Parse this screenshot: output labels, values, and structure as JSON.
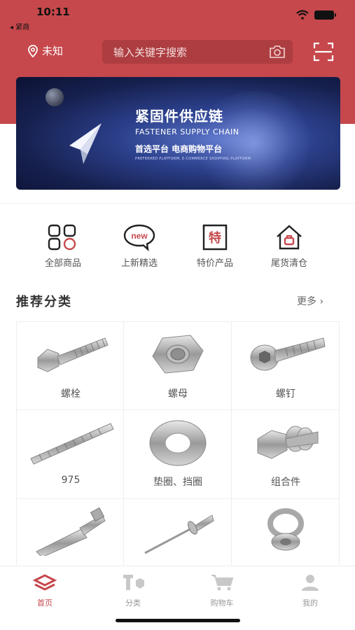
{
  "status_bar": {
    "time": "10:11",
    "back_label": "◂ 紧商"
  },
  "header": {
    "location": "未知",
    "search_placeholder": "输入关键字搜索"
  },
  "banner": {
    "title": "紧固件供应链",
    "subtitle_en": "FASTENER SUPPLY CHAIN",
    "subtitle_cn": "首选平台 电商购物平台",
    "tagline": "PREFERRED PLATFORM, E-COMMERCE SHOPPING PLATFORM"
  },
  "quick_nav": [
    {
      "label": "全部商品",
      "icon": "grid-icon"
    },
    {
      "label": "上新精选",
      "icon": "new-badge-icon",
      "badge": "new"
    },
    {
      "label": "特价产品",
      "icon": "special-price-icon",
      "glyph": "特"
    },
    {
      "label": "尾货清仓",
      "icon": "clearance-house-icon"
    }
  ],
  "recommended": {
    "title": "推荐分类",
    "more_label": "更多 ›",
    "categories": [
      {
        "label": "螺栓",
        "icon": "bolt-icon"
      },
      {
        "label": "螺母",
        "icon": "nut-icon"
      },
      {
        "label": "螺钉",
        "icon": "screw-icon"
      },
      {
        "label": "975",
        "icon": "threaded-rod-icon"
      },
      {
        "label": "垫圈、挡圈",
        "icon": "washer-icon"
      },
      {
        "label": "组合件",
        "icon": "assembly-icon"
      },
      {
        "label": "",
        "icon": "anchor-bolt-icon"
      },
      {
        "label": "",
        "icon": "rivet-icon"
      },
      {
        "label": "",
        "icon": "eye-bolt-icon"
      }
    ]
  },
  "tabbar": [
    {
      "label": "首页",
      "icon": "home-logo-icon",
      "active": true
    },
    {
      "label": "分类",
      "icon": "category-icon",
      "active": false
    },
    {
      "label": "购物车",
      "icon": "cart-icon",
      "active": false
    },
    {
      "label": "我的",
      "icon": "user-icon",
      "active": false
    }
  ],
  "colors": {
    "brand": "#c6484c",
    "muted": "#999999"
  }
}
